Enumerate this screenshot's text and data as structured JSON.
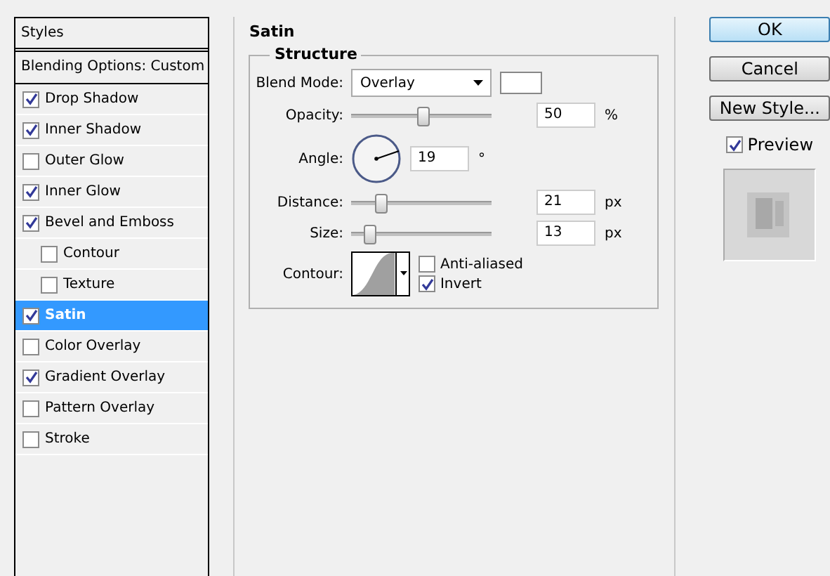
{
  "styles_panel": {
    "header": "Styles",
    "blending_options": "Blending Options: Custom",
    "items": [
      {
        "label": "Drop Shadow",
        "checked": true,
        "selected": false
      },
      {
        "label": "Inner Shadow",
        "checked": true,
        "selected": false
      },
      {
        "label": "Outer Glow",
        "checked": false,
        "selected": false
      },
      {
        "label": "Inner Glow",
        "checked": true,
        "selected": false
      },
      {
        "label": "Bevel and Emboss",
        "checked": true,
        "selected": false,
        "children": [
          {
            "label": "Contour",
            "checked": false,
            "selected": false
          },
          {
            "label": "Texture",
            "checked": false,
            "selected": false
          }
        ]
      },
      {
        "label": "Satin",
        "checked": true,
        "selected": true
      },
      {
        "label": "Color Overlay",
        "checked": false,
        "selected": false
      },
      {
        "label": "Gradient Overlay",
        "checked": true,
        "selected": false
      },
      {
        "label": "Pattern Overlay",
        "checked": false,
        "selected": false
      },
      {
        "label": "Stroke",
        "checked": false,
        "selected": false
      }
    ]
  },
  "satin": {
    "title": "Satin",
    "structure": {
      "title": "Structure",
      "blend_mode": {
        "label": "Blend Mode:",
        "value": "Overlay"
      },
      "opacity": {
        "label": "Opacity:",
        "level": 0.5,
        "value": "50",
        "unit": "%"
      },
      "angle": {
        "label": "Angle:",
        "value": "19",
        "unit": "°"
      },
      "distance": {
        "label": "Distance:",
        "level": 0.2,
        "value": "21",
        "unit": "px"
      },
      "size": {
        "label": "Size:",
        "level": 0.12,
        "value": "13",
        "unit": "px"
      },
      "contour": {
        "label": "Contour:"
      },
      "anti_aliased": {
        "label": "Anti-aliased",
        "checked": false
      },
      "invert": {
        "label": "Invert",
        "checked": true
      }
    }
  },
  "buttons": [
    {
      "label": "OK",
      "default": true
    },
    {
      "label": "Cancel",
      "default": false
    },
    {
      "label": "New Style...",
      "default": false
    }
  ],
  "preview": {
    "label": "Preview",
    "checked": true
  }
}
